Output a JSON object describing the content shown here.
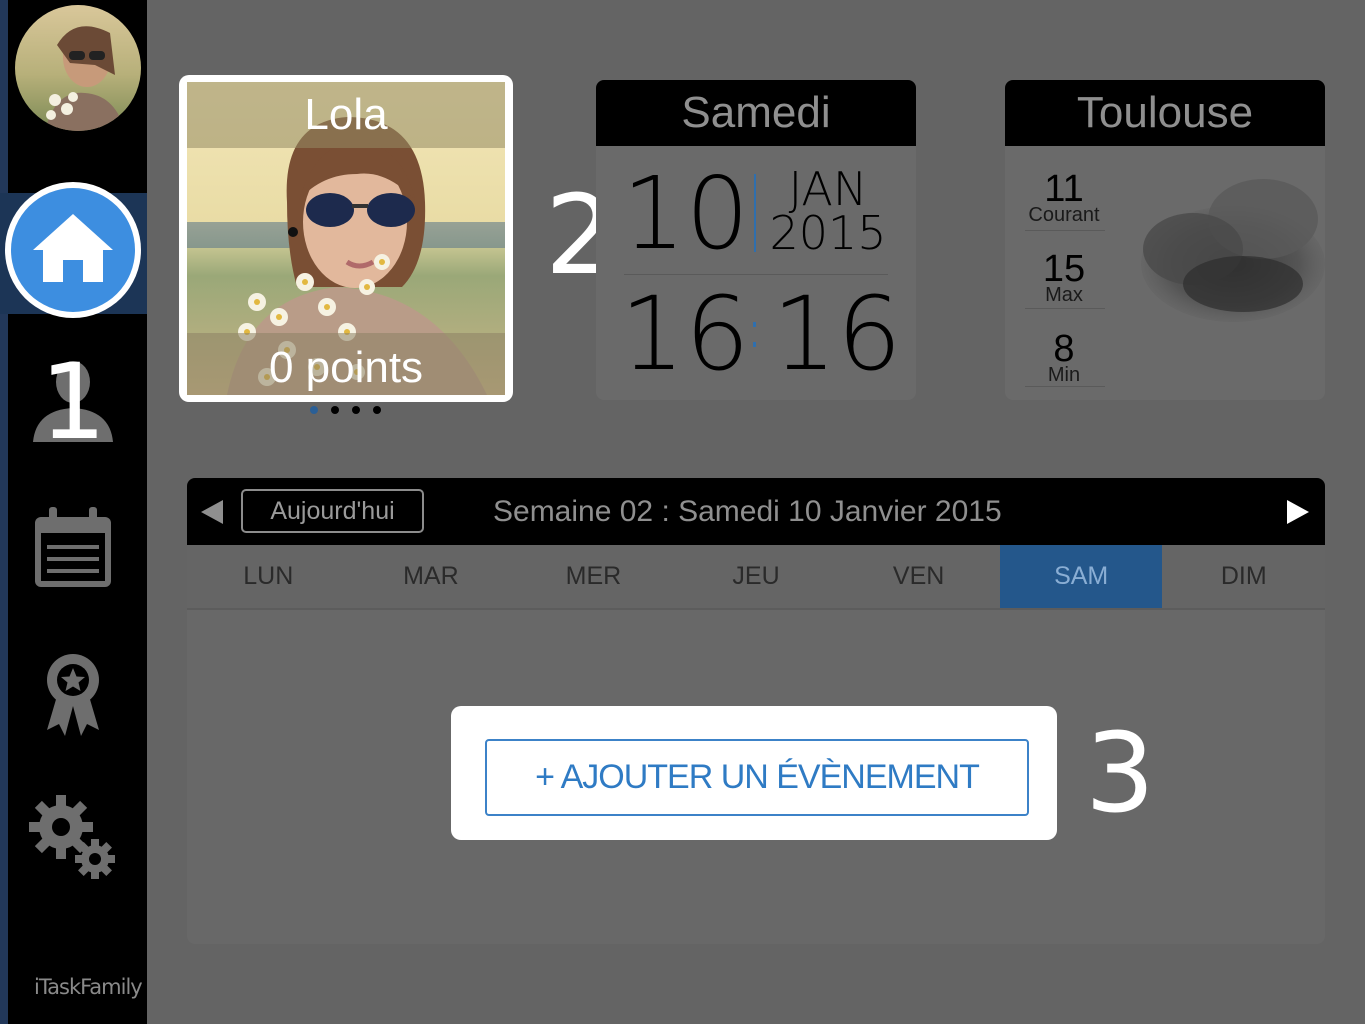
{
  "sidebar": {
    "brand": "iTaskFamily",
    "items": [
      {
        "name": "home",
        "icon": "home-icon"
      },
      {
        "name": "profile",
        "icon": "user-icon"
      },
      {
        "name": "calendar",
        "icon": "calendar-icon"
      },
      {
        "name": "rewards",
        "icon": "award-icon"
      },
      {
        "name": "settings",
        "icon": "gears-icon"
      }
    ]
  },
  "annotations": [
    "1",
    "2",
    "3"
  ],
  "profile": {
    "name": "Lola",
    "points": "0 points",
    "pager_count": 4,
    "pager_active": 0
  },
  "date_widget": {
    "day_name": "Samedi",
    "day": "10",
    "month": "JAN",
    "year": "2015",
    "hour": "16",
    "minute": "16"
  },
  "weather": {
    "city": "Toulouse",
    "current_value": "11",
    "current_label": "Courant",
    "max_value": "15",
    "max_label": "Max",
    "min_value": "8",
    "min_label": "Min",
    "condition_icon": "cloud-icon"
  },
  "calendar": {
    "today_label": "Aujourd'hui",
    "week_title": "Semaine 02 : Samedi 10 Janvier 2015",
    "days": [
      "LUN",
      "MAR",
      "MER",
      "JEU",
      "VEN",
      "SAM",
      "DIM"
    ],
    "selected_day": "SAM",
    "add_event_label": "+ AJOUTER UN ÉVÈNEMENT"
  },
  "colors": {
    "accent": "#3d8ee0",
    "selected_day": "#24578b",
    "add_button": "#2f7bc4"
  }
}
